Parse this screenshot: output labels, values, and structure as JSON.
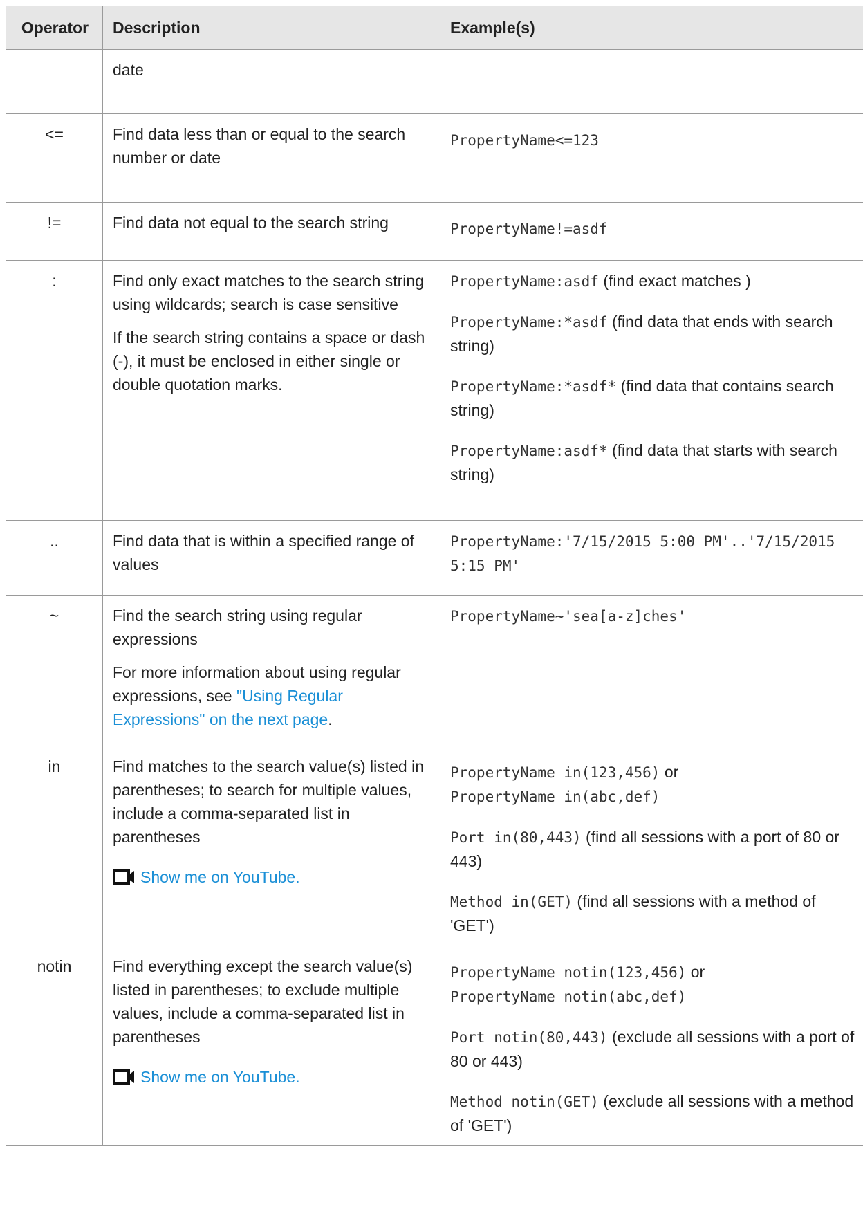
{
  "headers": {
    "operator": "Operator",
    "description": "Description",
    "examples": "Example(s)"
  },
  "rows": [
    {
      "op": "",
      "desc": [
        "date"
      ],
      "ex": []
    },
    {
      "op": "<=",
      "desc": [
        "Find data less than or equal to the search number or date"
      ],
      "ex": [
        {
          "code": "PropertyName<=123",
          "text": ""
        }
      ]
    },
    {
      "op": "!=",
      "desc": [
        "Find data not equal to the search string"
      ],
      "ex": [
        {
          "code": "PropertyName!=asdf",
          "text": ""
        }
      ]
    },
    {
      "op": ":",
      "desc": [
        "Find only exact matches to the search string using wildcards; search is case sensitive",
        "If the search string contains a space or dash (-), it must be enclosed in either single or double quotation marks."
      ],
      "ex": [
        {
          "code": "PropertyName:asdf",
          "text": " (find exact matches )"
        },
        {
          "code": "PropertyName:*asdf",
          "text": " (find data that ends with search string)"
        },
        {
          "code": "PropertyName:*asdf*",
          "text": " (find data that contains search string)"
        },
        {
          "code": "PropertyName:asdf*",
          "text": " (find data that starts with search string)"
        }
      ]
    },
    {
      "op": "..",
      "desc": [
        "Find data that is within a specified range of values"
      ],
      "ex": [
        {
          "code": "PropertyName:'7/15/2015 5:00 PM'..'7/15/2015 5:15 PM'",
          "text": ""
        }
      ]
    },
    {
      "op": "~",
      "desc": [
        "Find the search string using regular expressions"
      ],
      "desc_more": "For more information about using regular expressions, see ",
      "desc_link": "\"Using Regular Expressions\" on the next page",
      "desc_end": ".",
      "ex": [
        {
          "code": "PropertyName~'sea[a-z]ches'",
          "text": ""
        }
      ]
    },
    {
      "op": "in",
      "desc": [
        "Find matches to the search value(s) listed in parentheses; to search for multiple values, include a comma-separated list in parentheses"
      ],
      "video": "Show me on YouTube.",
      "ex_a": {
        "code": "PropertyName in(123,456)",
        "text": " or"
      },
      "ex_b": {
        "code": "PropertyName in(abc,def)",
        "text": ""
      },
      "ex": [
        {
          "code": "Port in(80,443)",
          "text": " (find all sessions with a port of 80 or 443)"
        },
        {
          "code": "Method in(GET)",
          "text": " (find all sessions with a method of 'GET')"
        }
      ]
    },
    {
      "op": "notin",
      "desc": [
        "Find everything except the search value(s) listed in parentheses; to exclude multiple values, include a comma-separated list in parentheses"
      ],
      "video": "Show me on YouTube.",
      "ex_a": {
        "code": "PropertyName notin(123,456)",
        "text": " or"
      },
      "ex_b": {
        "code": "PropertyName notin(abc,def)",
        "text": ""
      },
      "ex": [
        {
          "code": "Port notin(80,443)",
          "text": " (exclude all sessions with a port of 80 or 443)"
        },
        {
          "code": "Method notin(GET)",
          "text": " (exclude all sessions with a method of 'GET')"
        }
      ]
    }
  ]
}
